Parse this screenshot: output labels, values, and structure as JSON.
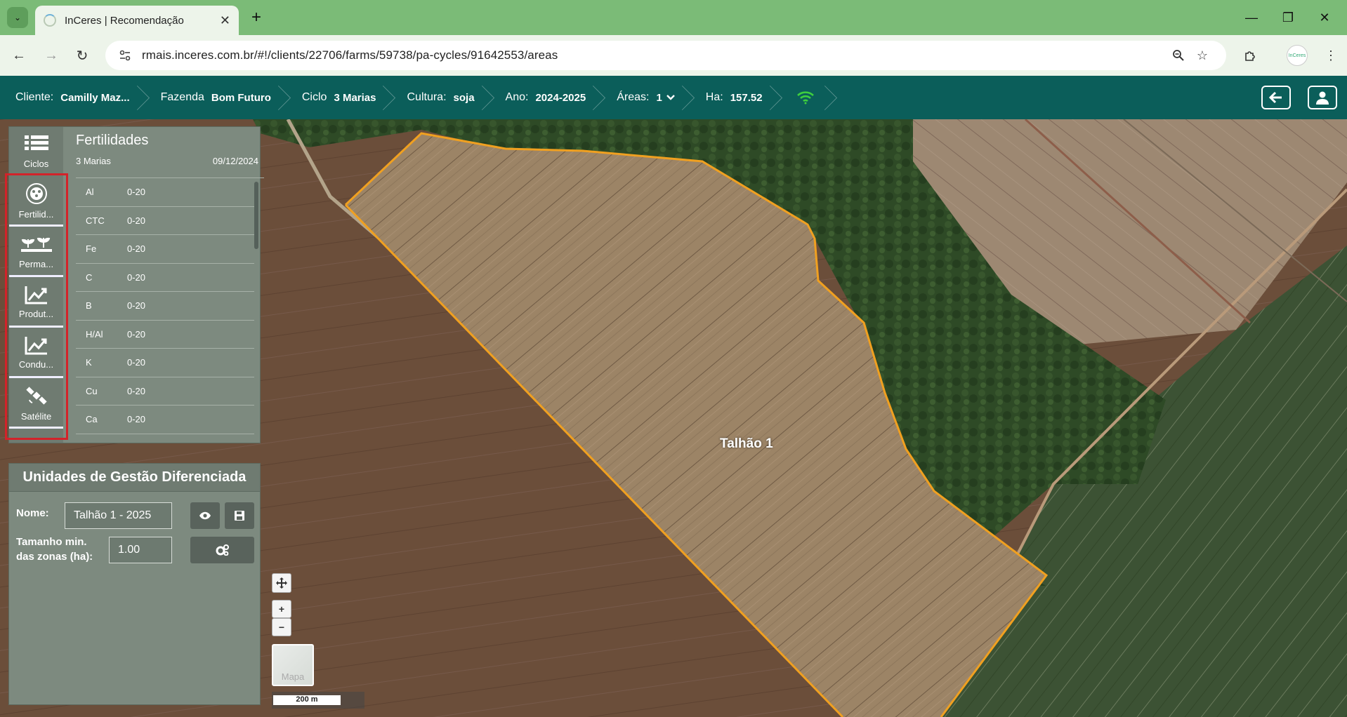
{
  "browser": {
    "tab_title": "InCeres | Recomendação",
    "url": "rmais.inceres.com.br/#!/clients/22706/farms/59738/pa-cycles/91642553/areas",
    "profile_label": "InCeres"
  },
  "header": {
    "crumbs": [
      {
        "label": "Cliente:",
        "value": "Camilly Maz..."
      },
      {
        "label": "Fazenda",
        "value": "Bom Futuro"
      },
      {
        "label": "Ciclo",
        "value": "3 Marias"
      },
      {
        "label": "Cultura:",
        "value": "soja"
      },
      {
        "label": "Ano:",
        "value": "2024-2025"
      },
      {
        "label": "Áreas:",
        "value": "1"
      },
      {
        "label": "Ha:",
        "value": "157.52"
      }
    ],
    "wifi_color": "#3ecf3e"
  },
  "sidebar": {
    "items": [
      {
        "label": "Ciclos",
        "icon": "list-icon"
      },
      {
        "label": "Fertilid...",
        "icon": "fertility-icon"
      },
      {
        "label": "Perma...",
        "icon": "plants-icon"
      },
      {
        "label": "Produt...",
        "icon": "chart-line-icon"
      },
      {
        "label": "Condu...",
        "icon": "chart-line-icon"
      },
      {
        "label": "Satélite",
        "icon": "satellite-icon"
      }
    ]
  },
  "fertility": {
    "title": "Fertilidades",
    "cycle": "3 Marias",
    "date": "09/12/2024",
    "rows": [
      {
        "element": "Al",
        "depth": "0-20"
      },
      {
        "element": "CTC",
        "depth": "0-20"
      },
      {
        "element": "Fe",
        "depth": "0-20"
      },
      {
        "element": "C",
        "depth": "0-20"
      },
      {
        "element": "B",
        "depth": "0-20"
      },
      {
        "element": "H/Al",
        "depth": "0-20"
      },
      {
        "element": "K",
        "depth": "0-20"
      },
      {
        "element": "Cu",
        "depth": "0-20"
      },
      {
        "element": "Ca",
        "depth": "0-20"
      }
    ]
  },
  "ugd": {
    "title": "Unidades de Gestão Diferenciada",
    "name_label": "Nome:",
    "name_value": "Talhão 1 - 2025",
    "size_label_1": "Tamanho min.",
    "size_label_2": "das zonas (ha):",
    "size_value": "1.00"
  },
  "map": {
    "field_label": "Talhão 1",
    "basemap_label": "Mapa",
    "scale_label": "200 m",
    "boundary_color": "#f0a020"
  }
}
